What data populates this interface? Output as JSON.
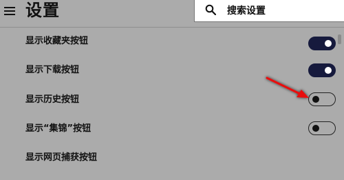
{
  "header": {
    "title": "设置",
    "menu_icon": "hamburger-menu-icon"
  },
  "search": {
    "icon": "search-icon",
    "placeholder": "搜索设置"
  },
  "settings": [
    {
      "label": "显示收藏夹按钮",
      "enabled": true
    },
    {
      "label": "显示下载按钮",
      "enabled": true
    },
    {
      "label": "显示历史按钮",
      "enabled": false
    },
    {
      "label": "显示“集锦”按钮",
      "enabled": false
    },
    {
      "label": "显示网页捕获按钮"
    }
  ],
  "annotation": {
    "type": "red-arrow-icon",
    "color": "#e81010"
  },
  "colors": {
    "background": "#ababab",
    "toggle_on": "#161a3d"
  }
}
